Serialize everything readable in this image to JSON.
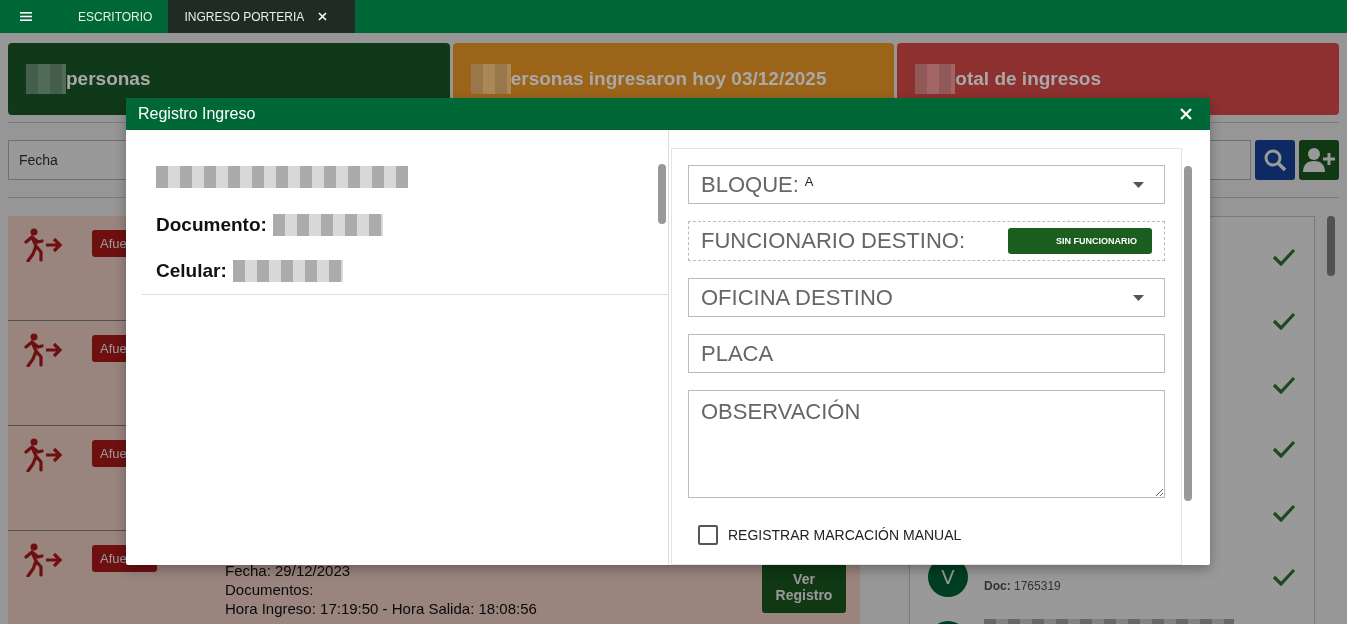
{
  "top_bar": {
    "tabs": [
      {
        "label": "ESCRITORIO",
        "selected": false,
        "closable": false
      },
      {
        "label": "INGRESO PORTERIA",
        "selected": true,
        "closable": true
      }
    ]
  },
  "summary_cards": [
    {
      "text": "personas",
      "color": "#10391a"
    },
    {
      "text": "ersonas ingresaron hoy 03/12/2025",
      "color": "#9c6419"
    },
    {
      "text": "otal de ingresos",
      "color": "#8f3030"
    }
  ],
  "filter": {
    "placeholder": "Fecha"
  },
  "records": [
    {
      "badge": "Afue"
    },
    {
      "badge": "Afue"
    },
    {
      "badge": "Afue"
    },
    {
      "badge": "Afue",
      "lines": [
        "Fecha: 29/12/2023",
        "Documentos:",
        "Hora Ingreso: 17:19:50 - Hora Salida: 18:08:56"
      ],
      "button": "Ver Registro"
    }
  ],
  "visitors": [
    {
      "kind": "hidden"
    },
    {
      "kind": "hidden"
    },
    {
      "kind": "hidden"
    },
    {
      "kind": "hidden"
    },
    {
      "kind": "hidden"
    },
    {
      "kind": "person",
      "initial": "V",
      "doc": "**Doc:** 1765319"
    },
    {
      "kind": "redacted"
    }
  ],
  "modal": {
    "title": "Registro Ingreso",
    "details": [
      {
        "label": "Documento:"
      },
      {
        "label": "Celular:"
      }
    ],
    "form": [
      {
        "kind": "select",
        "label": "BLOQUE:",
        "value": "A"
      },
      {
        "kind": "picker",
        "label": "FUNCIONARIO DESTINO:",
        "button": "SIN FUNCIONARIO"
      },
      {
        "kind": "select",
        "placeholder": "OFICINA DESTINO"
      },
      {
        "kind": "input",
        "placeholder": "PLACA"
      },
      {
        "kind": "textarea",
        "placeholder": "OBSERVACIÓN"
      },
      {
        "kind": "checkbox",
        "label": "REGISTRAR MARCACIÓN MANUAL",
        "checked": false
      }
    ]
  }
}
